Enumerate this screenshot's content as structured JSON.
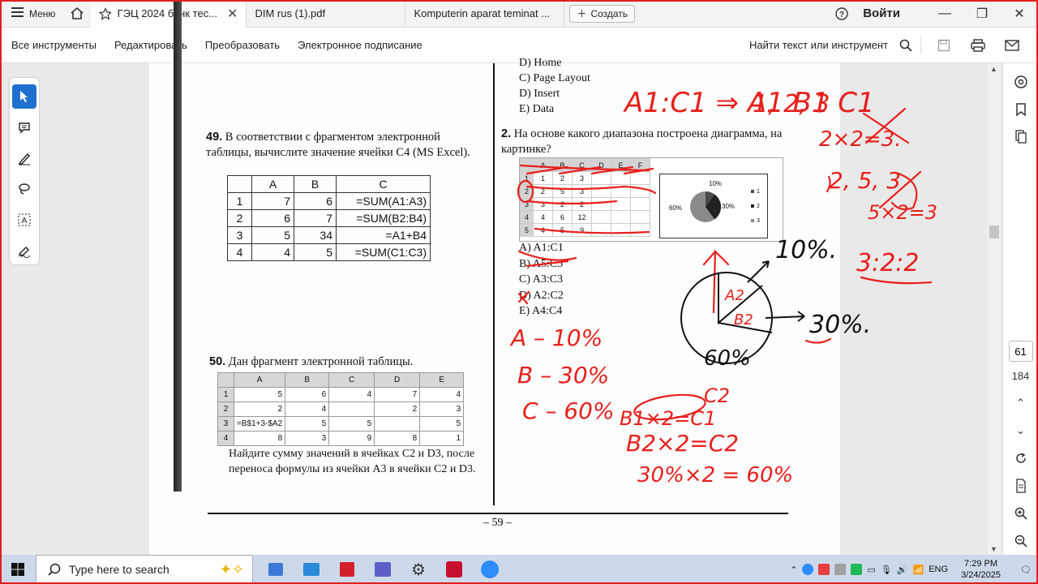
{
  "tabbar": {
    "menu_label": "Меню",
    "tabs": [
      {
        "label": "ГЭЦ 2024 банк тес..."
      },
      {
        "label": "DIM rus  (1).pdf"
      },
      {
        "label": "Komputerin aparat teminat ..."
      }
    ],
    "create_label": "Создать",
    "login_label": "Войти"
  },
  "toolbar": {
    "items": [
      "Все инструменты",
      "Редактировать",
      "Преобразовать",
      "Электронное подписание"
    ],
    "find_label": "Найти текст или инструмент"
  },
  "document": {
    "top_answers": [
      "D) Home",
      "C) Page Layout",
      "D) Insert",
      "E) Data"
    ],
    "q49": {
      "number": "49.",
      "text": "В соответствии с фрагментом электронной таблицы, вычислите значение ячейки C4 (MS Excel).",
      "headers": [
        "",
        "A",
        "B",
        "C"
      ],
      "rows": [
        [
          "1",
          "7",
          "6",
          "=SUM(A1:A3)"
        ],
        [
          "2",
          "6",
          "7",
          "=SUM(B2:B4)"
        ],
        [
          "3",
          "5",
          "34",
          "=A1+B4"
        ],
        [
          "4",
          "4",
          "5",
          "=SUM(C1:C3)"
        ]
      ]
    },
    "q50": {
      "number": "50.",
      "text": "Дан фрагмент электронной таблицы.",
      "headers": [
        "",
        "A",
        "B",
        "C",
        "D",
        "E"
      ],
      "rows": [
        [
          "1",
          "5",
          "6",
          "4",
          "7",
          "4"
        ],
        [
          "2",
          "2",
          "4",
          "",
          "2",
          "3"
        ],
        [
          "3",
          "=B$1+3-$A2",
          "5",
          "5",
          "",
          "5"
        ],
        [
          "4",
          "8",
          "3",
          "9",
          "8",
          "1"
        ]
      ],
      "question": "Найдите сумму значений в ячейках C2 и D3, после переноса формулы из ячейки A3 в ячейки C2 и D3."
    },
    "q2": {
      "number": "2.",
      "text": "На основе какого диапазона построена диаграмма, на картинке?",
      "sheet_headers": [
        "",
        "A",
        "B",
        "C",
        "D",
        "E",
        "F"
      ],
      "sheet_rows": [
        [
          "1",
          "1",
          "2",
          "3"
        ],
        [
          "2",
          "2",
          "5",
          "3"
        ],
        [
          "3",
          "3",
          "2",
          "2"
        ],
        [
          "4",
          "4",
          "6",
          "12"
        ],
        [
          "5",
          "4",
          "5",
          "9"
        ]
      ],
      "pie_labels": [
        "10%",
        "30%",
        "60%"
      ],
      "legend": [
        "1",
        "2",
        "3"
      ],
      "answers": [
        "A) A1:C1",
        "B) A5:C5",
        "C) A3:C3",
        "D) A2:C2",
        "E) A4:C4"
      ]
    },
    "page_number": "– 59 –"
  },
  "handwriting": {
    "notes": [
      "A1:C1 ⇒ A1 B1 C1",
      "1, 2, 3",
      "2×2=3.",
      "2, 5, 3",
      "5×2=3",
      "3:2:2",
      "10%.",
      "30%.",
      "A2",
      "B2",
      "60%",
      "A – 10%",
      "B – 30%",
      "C – 60%",
      "C2",
      "B1×2=C1",
      "B2×2=C2",
      "30%×2 = 60%"
    ],
    "color": "#e8201c"
  },
  "right_panel": {
    "current_page": "61",
    "total_pages": "184"
  },
  "taskbar": {
    "search_placeholder": "Type here to search",
    "lang": "ENG",
    "time": "7:29 PM",
    "date": "3/24/2025"
  },
  "colors": {
    "accent": "#1f6fd1",
    "ink": "#e8201c",
    "frame": "#e02020"
  }
}
